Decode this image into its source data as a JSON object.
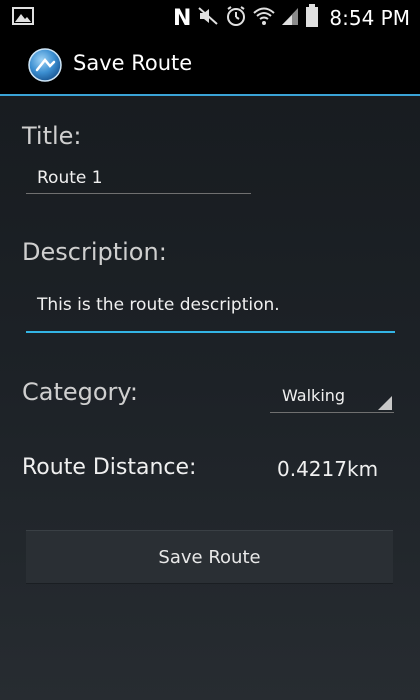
{
  "status_bar": {
    "time": "8:54 PM",
    "nfc_letter": "N",
    "icons": [
      "picture-icon",
      "mute-icon",
      "alarm-icon",
      "wifi-icon",
      "signal-icon",
      "battery-icon"
    ]
  },
  "action_bar": {
    "title": "Save Route",
    "icon": "app-globe-icon"
  },
  "form": {
    "title_label": "Title:",
    "title_value": "Route 1",
    "description_label": "Description:",
    "description_value": "This is the route description.",
    "category_label": "Category:",
    "category_selected": "Walking",
    "distance_label": "Route Distance:",
    "distance_value": "0.4217km"
  },
  "save_button_label": "Save Route",
  "colors": {
    "accent": "#33b5e5",
    "background": "#1d2227"
  }
}
